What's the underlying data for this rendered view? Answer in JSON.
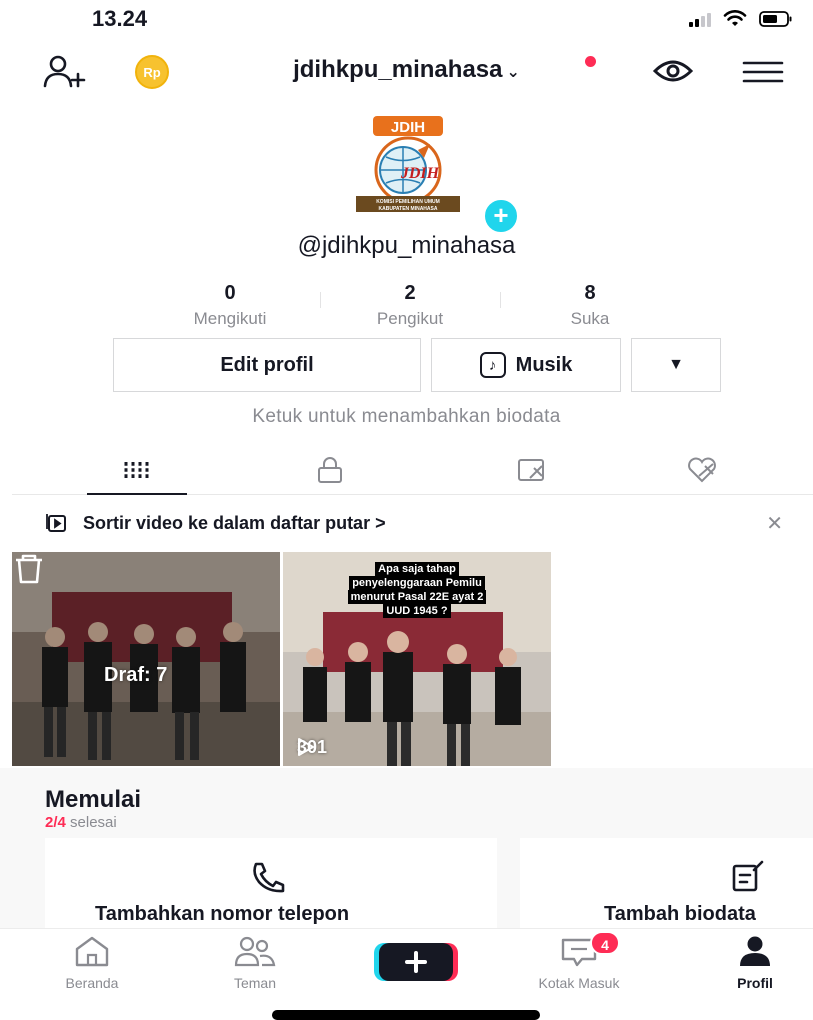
{
  "status_bar": {
    "time": "13.24"
  },
  "header": {
    "username": "jdihkpu_minahasa",
    "coin_label": "Rp"
  },
  "profile": {
    "logo_text": "JDIH",
    "logo_caption_1": "KOMISI PEMILIHAN UMUM",
    "logo_caption_2": "KABUPATEN MINAHASA",
    "handle": "@jdihkpu_minahasa",
    "stats": [
      {
        "value": "0",
        "label": "Mengikuti"
      },
      {
        "value": "2",
        "label": "Pengikut"
      },
      {
        "value": "8",
        "label": "Suka"
      }
    ],
    "edit_label": "Edit profil",
    "music_label": "Musik",
    "bio_hint": "Ketuk untuk menambahkan biodata"
  },
  "tabs": [
    "videos-grid",
    "private",
    "reposts",
    "liked"
  ],
  "playlist_banner": {
    "text": "Sortir video ke dalam daftar putar >"
  },
  "videos": [
    {
      "overlay": "Draf: 7"
    },
    {
      "caption_1": "Apa saja tahap",
      "caption_2": "penyelenggaraan Pemilu",
      "caption_3": "menurut Pasal 22E ayat 2",
      "caption_4": "UUD 1945 ?",
      "views": "301"
    }
  ],
  "getting_started": {
    "title": "Memulai",
    "progress": "2/4",
    "progress_suffix": " selesai",
    "cards": [
      {
        "label": "Tambahkan nomor telepon",
        "icon": "phone-icon"
      },
      {
        "label": "Tambah biodata",
        "icon": "edit-bio-icon"
      }
    ]
  },
  "bottom_nav": {
    "items": [
      "Beranda",
      "Teman",
      "Kotak Masuk",
      "Profil"
    ],
    "inbox_badge": "4"
  },
  "colors": {
    "accent": "#fe2c55",
    "cyan": "#20d5ec",
    "text": "#161823",
    "muted": "#8a8b91"
  }
}
